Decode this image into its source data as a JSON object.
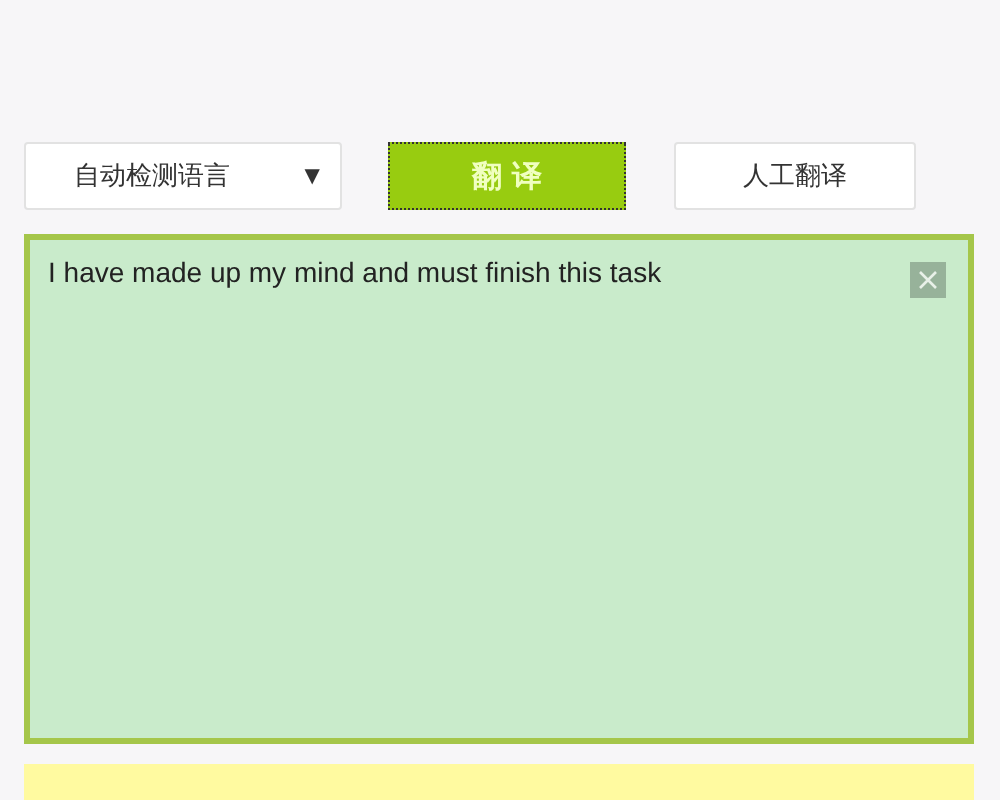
{
  "language_select": {
    "value": "自动检测语言",
    "caret": "▼"
  },
  "translate_button": {
    "label": "翻 译"
  },
  "human_translate_button": {
    "label": "人工翻译"
  },
  "source_text": {
    "value": "I have made up my mind and must finish this task"
  }
}
